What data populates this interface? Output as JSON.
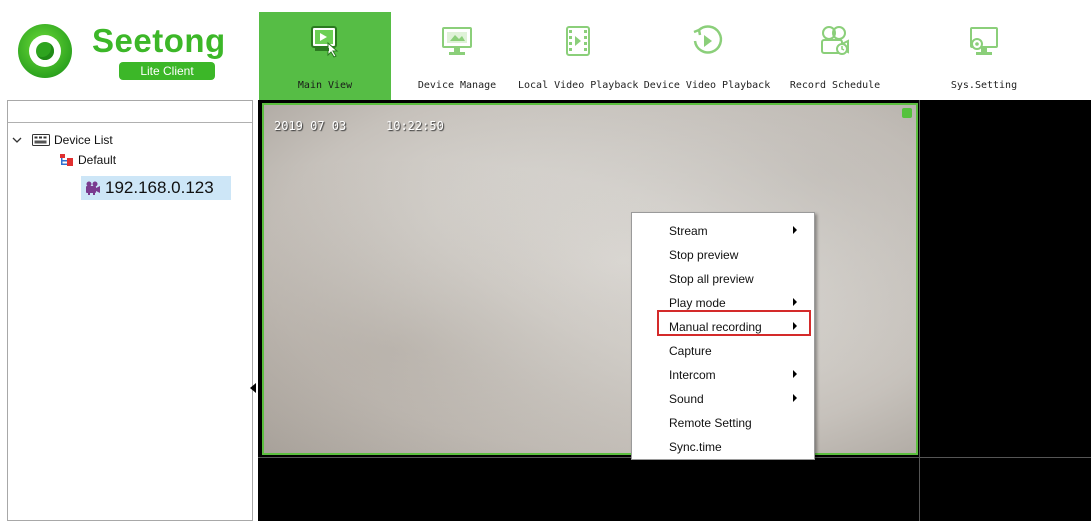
{
  "app": {
    "brand": "Seetong",
    "subtitle": "Lite Client"
  },
  "toolbar": {
    "buttons": [
      {
        "label": "Main View",
        "icon": "main-view-icon",
        "active": true
      },
      {
        "label": "Device Manage",
        "icon": "device-manage-icon",
        "active": false
      },
      {
        "label": "Local Video Playback",
        "icon": "local-playback-icon",
        "active": false
      },
      {
        "label": "Device Video Playback",
        "icon": "device-playback-icon",
        "active": false
      },
      {
        "label": "Record Schedule",
        "icon": "record-schedule-icon",
        "active": false
      },
      {
        "label": "Sys.Setting",
        "icon": "sys-setting-icon",
        "active": false
      }
    ]
  },
  "tree": {
    "search_value": "",
    "root": "Device List",
    "group": "Default",
    "device": "192.168.0.123"
  },
  "video": {
    "osd_date": "2019 07 03",
    "osd_time": "10:22:50"
  },
  "context_menu": {
    "items": [
      {
        "label": "Stream",
        "submenu": true
      },
      {
        "label": "Stop preview",
        "submenu": false
      },
      {
        "label": "Stop all preview",
        "submenu": false
      },
      {
        "label": "Play mode",
        "submenu": true
      },
      {
        "label": "Manual recording",
        "submenu": true,
        "highlighted": true
      },
      {
        "label": "Capture",
        "submenu": false
      },
      {
        "label": "Intercom",
        "submenu": true
      },
      {
        "label": "Sound",
        "submenu": true
      },
      {
        "label": "Remote Setting",
        "submenu": false
      },
      {
        "label": "Sync.time",
        "submenu": false
      }
    ]
  },
  "colors": {
    "accent_green": "#56bd45",
    "brand_green": "#3cb728",
    "highlight_red": "#d42a2a"
  }
}
